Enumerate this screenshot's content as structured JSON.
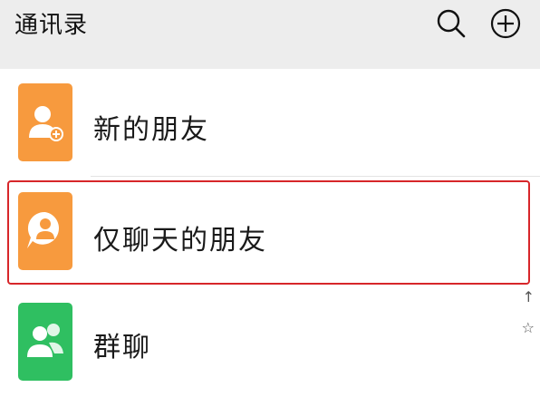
{
  "header": {
    "title": "通讯录",
    "search_icon": "search-icon",
    "add_icon": "plus-circle-icon"
  },
  "colors": {
    "header_bg": "#ededed",
    "orange": "#f79a3e",
    "green": "#2fbf61",
    "highlight": "#d7262a"
  },
  "contacts": [
    {
      "label": "新的朋友",
      "icon": "add-friend-icon"
    },
    {
      "label": "仅聊天的朋友",
      "icon": "chat-person-icon"
    },
    {
      "label": "群聊",
      "icon": "group-chat-icon"
    }
  ],
  "side_index": [
    "↑",
    "☆"
  ]
}
